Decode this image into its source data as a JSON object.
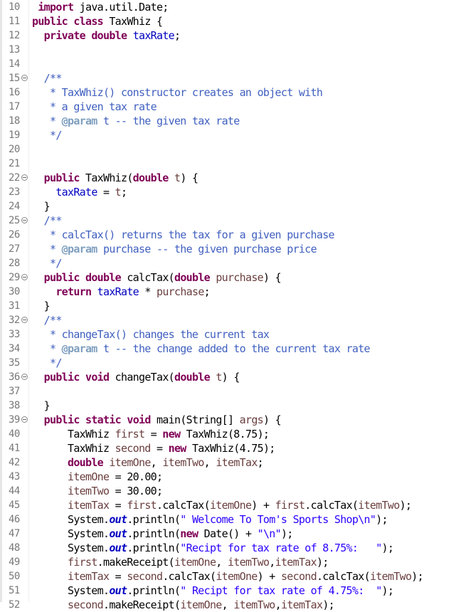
{
  "editor": {
    "language": "java",
    "fold_icon": "collapse-icon",
    "lines": [
      {
        "n": "10",
        "fold": false,
        "tokens": [
          [
            " ",
            ""
          ],
          [
            "import",
            "kw"
          ],
          [
            " java.util.Date;",
            ""
          ]
        ]
      },
      {
        "n": "11",
        "fold": false,
        "tokens": [
          [
            "public",
            "kw"
          ],
          [
            " ",
            ""
          ],
          [
            "class",
            "kw"
          ],
          [
            " TaxWhiz {",
            ""
          ]
        ]
      },
      {
        "n": "12",
        "fold": false,
        "tokens": [
          [
            "  ",
            ""
          ],
          [
            "private",
            "kw"
          ],
          [
            " ",
            ""
          ],
          [
            "double",
            "kw"
          ],
          [
            " ",
            ""
          ],
          [
            "taxRate",
            "fld"
          ],
          [
            ";",
            ""
          ]
        ]
      },
      {
        "n": "13",
        "fold": false,
        "tokens": []
      },
      {
        "n": "14",
        "fold": false,
        "tokens": []
      },
      {
        "n": "15",
        "fold": true,
        "tokens": [
          [
            "  ",
            ""
          ],
          [
            "/**",
            "cmt"
          ]
        ]
      },
      {
        "n": "16",
        "fold": false,
        "tokens": [
          [
            "   * TaxWhiz() constructor creates an object with",
            "cmt"
          ]
        ]
      },
      {
        "n": "17",
        "fold": false,
        "tokens": [
          [
            "   * a given tax rate",
            "cmt"
          ]
        ]
      },
      {
        "n": "18",
        "fold": false,
        "tokens": [
          [
            "   * ",
            "cmt"
          ],
          [
            "@param",
            "tag"
          ],
          [
            " t -- the given tax rate",
            "cmt"
          ]
        ]
      },
      {
        "n": "19",
        "fold": false,
        "tokens": [
          [
            "   */",
            "cmt"
          ]
        ]
      },
      {
        "n": "20",
        "fold": false,
        "tokens": []
      },
      {
        "n": "21",
        "fold": false,
        "tokens": []
      },
      {
        "n": "22",
        "fold": true,
        "tokens": [
          [
            "  ",
            ""
          ],
          [
            "public",
            "kw"
          ],
          [
            " TaxWhiz(",
            ""
          ],
          [
            "double",
            "kw"
          ],
          [
            " ",
            ""
          ],
          [
            "t",
            "var"
          ],
          [
            ") {",
            ""
          ]
        ]
      },
      {
        "n": "23",
        "fold": false,
        "tokens": [
          [
            "    ",
            ""
          ],
          [
            "taxRate",
            "fld"
          ],
          [
            " = ",
            ""
          ],
          [
            "t",
            "var"
          ],
          [
            ";",
            ""
          ]
        ]
      },
      {
        "n": "24",
        "fold": false,
        "tokens": [
          [
            "  }",
            ""
          ]
        ]
      },
      {
        "n": "25",
        "fold": true,
        "tokens": [
          [
            "  ",
            ""
          ],
          [
            "/**",
            "cmt"
          ]
        ]
      },
      {
        "n": "26",
        "fold": false,
        "tokens": [
          [
            "   * calcTax() returns the tax for a given purchase",
            "cmt"
          ]
        ]
      },
      {
        "n": "27",
        "fold": false,
        "tokens": [
          [
            "   * ",
            "cmt"
          ],
          [
            "@param",
            "tag"
          ],
          [
            " purchase -- the given purchase price",
            "cmt"
          ]
        ]
      },
      {
        "n": "28",
        "fold": false,
        "tokens": [
          [
            "   */",
            "cmt"
          ]
        ]
      },
      {
        "n": "29",
        "fold": true,
        "tokens": [
          [
            "  ",
            ""
          ],
          [
            "public",
            "kw"
          ],
          [
            " ",
            ""
          ],
          [
            "double",
            "kw"
          ],
          [
            " calcTax(",
            ""
          ],
          [
            "double",
            "kw"
          ],
          [
            " ",
            ""
          ],
          [
            "purchase",
            "var"
          ],
          [
            ") {",
            ""
          ]
        ]
      },
      {
        "n": "30",
        "fold": false,
        "tokens": [
          [
            "    ",
            ""
          ],
          [
            "return",
            "kw"
          ],
          [
            " ",
            ""
          ],
          [
            "taxRate",
            "fld"
          ],
          [
            " * ",
            ""
          ],
          [
            "purchase",
            "var"
          ],
          [
            ";",
            ""
          ]
        ]
      },
      {
        "n": "31",
        "fold": false,
        "tokens": [
          [
            "  }",
            ""
          ]
        ]
      },
      {
        "n": "32",
        "fold": true,
        "tokens": [
          [
            "  ",
            ""
          ],
          [
            "/**",
            "cmt"
          ]
        ]
      },
      {
        "n": "33",
        "fold": false,
        "tokens": [
          [
            "   * changeTax() changes the current tax",
            "cmt"
          ]
        ]
      },
      {
        "n": "34",
        "fold": false,
        "tokens": [
          [
            "   * ",
            "cmt"
          ],
          [
            "@param",
            "tag"
          ],
          [
            " t -- the change added to the current tax rate",
            "cmt"
          ]
        ]
      },
      {
        "n": "35",
        "fold": false,
        "tokens": [
          [
            "   */",
            "cmt"
          ]
        ]
      },
      {
        "n": "36",
        "fold": true,
        "tokens": [
          [
            "  ",
            ""
          ],
          [
            "public",
            "kw"
          ],
          [
            " ",
            ""
          ],
          [
            "void",
            "kw"
          ],
          [
            " changeTax(",
            ""
          ],
          [
            "double",
            "kw"
          ],
          [
            " ",
            ""
          ],
          [
            "t",
            "var"
          ],
          [
            ") {",
            ""
          ]
        ]
      },
      {
        "n": "37",
        "fold": false,
        "tokens": []
      },
      {
        "n": "38",
        "fold": false,
        "tokens": [
          [
            "  }",
            ""
          ]
        ]
      },
      {
        "n": "39",
        "fold": true,
        "tokens": [
          [
            "  ",
            ""
          ],
          [
            "public",
            "kw"
          ],
          [
            " ",
            ""
          ],
          [
            "static",
            "kw"
          ],
          [
            " ",
            ""
          ],
          [
            "void",
            "kw"
          ],
          [
            " main(String[] ",
            ""
          ],
          [
            "args",
            "var"
          ],
          [
            ") {",
            ""
          ]
        ]
      },
      {
        "n": "40",
        "fold": false,
        "tokens": [
          [
            "      TaxWhiz ",
            ""
          ],
          [
            "first",
            "var"
          ],
          [
            " = ",
            ""
          ],
          [
            "new",
            "kw"
          ],
          [
            " TaxWhiz(8.75);",
            ""
          ]
        ]
      },
      {
        "n": "41",
        "fold": false,
        "tokens": [
          [
            "      TaxWhiz ",
            ""
          ],
          [
            "second",
            "var"
          ],
          [
            " = ",
            ""
          ],
          [
            "new",
            "kw"
          ],
          [
            " TaxWhiz(4.75);",
            ""
          ]
        ]
      },
      {
        "n": "42",
        "fold": false,
        "tokens": [
          [
            "      ",
            ""
          ],
          [
            "double",
            "kw"
          ],
          [
            " ",
            ""
          ],
          [
            "itemOne",
            "var"
          ],
          [
            ", ",
            ""
          ],
          [
            "itemTwo",
            "var"
          ],
          [
            ", ",
            ""
          ],
          [
            "itemTax",
            "var"
          ],
          [
            ";",
            ""
          ]
        ]
      },
      {
        "n": "43",
        "fold": false,
        "tokens": [
          [
            "      ",
            ""
          ],
          [
            "itemOne",
            "var"
          ],
          [
            " = 20.00;",
            ""
          ]
        ]
      },
      {
        "n": "44",
        "fold": false,
        "tokens": [
          [
            "      ",
            ""
          ],
          [
            "itemTwo",
            "var"
          ],
          [
            " = 30.00;",
            ""
          ]
        ]
      },
      {
        "n": "45",
        "fold": false,
        "tokens": [
          [
            "      ",
            ""
          ],
          [
            "itemTax",
            "var"
          ],
          [
            " = ",
            ""
          ],
          [
            "first",
            "var"
          ],
          [
            ".calcTax(",
            ""
          ],
          [
            "itemOne",
            "var"
          ],
          [
            ") + ",
            ""
          ],
          [
            "first",
            "var"
          ],
          [
            ".calcTax(",
            ""
          ],
          [
            "itemTwo",
            "var"
          ],
          [
            ");",
            ""
          ]
        ]
      },
      {
        "n": "46",
        "fold": false,
        "tokens": [
          [
            "      System.",
            ""
          ],
          [
            "out",
            "static-fld"
          ],
          [
            ".println(",
            ""
          ],
          [
            "\" Welcome To Tom's Sports Shop\\n\"",
            "str"
          ],
          [
            ");",
            ""
          ]
        ]
      },
      {
        "n": "47",
        "fold": false,
        "tokens": [
          [
            "      System.",
            ""
          ],
          [
            "out",
            "static-fld"
          ],
          [
            ".println(",
            ""
          ],
          [
            "new",
            "kw"
          ],
          [
            " Date() + ",
            ""
          ],
          [
            "\"\\n\"",
            "str"
          ],
          [
            ");",
            ""
          ]
        ]
      },
      {
        "n": "48",
        "fold": false,
        "tokens": [
          [
            "      System.",
            ""
          ],
          [
            "out",
            "static-fld"
          ],
          [
            ".println(",
            ""
          ],
          [
            "\"Recipt for tax rate of 8.75%:   \"",
            "str"
          ],
          [
            ");",
            ""
          ]
        ]
      },
      {
        "n": "49",
        "fold": false,
        "tokens": [
          [
            "      ",
            ""
          ],
          [
            "first",
            "var"
          ],
          [
            ".makeReceipt(",
            ""
          ],
          [
            "itemOne",
            "var"
          ],
          [
            ", ",
            ""
          ],
          [
            "itemTwo",
            "var"
          ],
          [
            ",",
            ""
          ],
          [
            "itemTax",
            "var"
          ],
          [
            ");",
            ""
          ]
        ]
      },
      {
        "n": "50",
        "fold": false,
        "tokens": [
          [
            "      ",
            ""
          ],
          [
            "itemTax",
            "var"
          ],
          [
            " = ",
            ""
          ],
          [
            "second",
            "var"
          ],
          [
            ".calcTax(",
            ""
          ],
          [
            "itemOne",
            "var"
          ],
          [
            ") + ",
            ""
          ],
          [
            "second",
            "var"
          ],
          [
            ".calcTax(",
            ""
          ],
          [
            "itemTwo",
            "var"
          ],
          [
            ");",
            ""
          ]
        ]
      },
      {
        "n": "51",
        "fold": false,
        "tokens": [
          [
            "      System.",
            ""
          ],
          [
            "out",
            "static-fld"
          ],
          [
            ".println(",
            ""
          ],
          [
            "\" Recipt for tax rate of 4.75%:  \"",
            "str"
          ],
          [
            ");",
            ""
          ]
        ]
      },
      {
        "n": "52",
        "fold": false,
        "tokens": [
          [
            "      ",
            ""
          ],
          [
            "second",
            "var"
          ],
          [
            ".makeReceipt(",
            ""
          ],
          [
            "itemOne",
            "var"
          ],
          [
            ", ",
            ""
          ],
          [
            "itemTwo",
            "var"
          ],
          [
            ",",
            ""
          ],
          [
            "itemTax",
            "var"
          ],
          [
            ");",
            ""
          ]
        ]
      }
    ]
  }
}
